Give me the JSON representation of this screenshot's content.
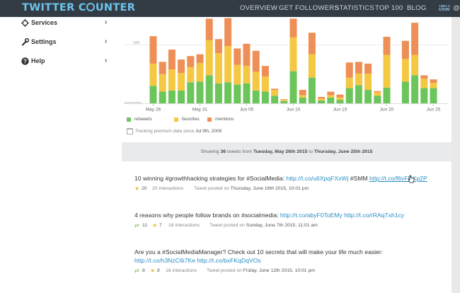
{
  "brand": {
    "part1": "TWITTER C",
    "part2": "UNTER",
    "accent": "#6cc3ec",
    "nav_bg": "#333c44"
  },
  "nav": {
    "items": [
      "OVERVIEW",
      "GET FOLLOWERS",
      "STATISTICS",
      "TOP 100",
      "BLOG"
    ],
    "mini_badge": "TWITTER COUNTER",
    "at_symbol": "@"
  },
  "sidebar": {
    "items": [
      {
        "label": "Services",
        "icon": "crosshair-icon"
      },
      {
        "label": "Settings",
        "icon": "wrench-icon"
      },
      {
        "label": "Help",
        "icon": "help-icon"
      }
    ]
  },
  "chart_data": {
    "type": "bar",
    "stacked": true,
    "colors": {
      "retweets": "#6bc55b",
      "favorites": "#f4c842",
      "mentions": "#ee8f57"
    },
    "gridline_value": 100,
    "ylim": [
      0,
      160
    ],
    "tick_labels": [
      "May 26",
      "May 31",
      "Jun 05",
      "Jun 10",
      "Jun 15",
      "Jun 20",
      "Jun 25"
    ],
    "tick_index": [
      0,
      5,
      10,
      15,
      20,
      25,
      30
    ],
    "categories": [
      "May 26",
      "May 27",
      "May 28",
      "May 29",
      "May 30",
      "May 31",
      "Jun 01",
      "Jun 02",
      "Jun 03",
      "Jun 04",
      "Jun 05",
      "Jun 06",
      "Jun 07",
      "Jun 08",
      "Jun 09",
      "Jun 10",
      "Jun 11",
      "Jun 12",
      "Jun 13",
      "Jun 14",
      "Jun 15",
      "Jun 16",
      "Jun 17",
      "Jun 18",
      "Jun 19",
      "Jun 20",
      "Jun 21",
      "Jun 22",
      "Jun 23",
      "Jun 24",
      "Jun 25"
    ],
    "series": [
      {
        "name": "retweets",
        "values": [
          30,
          20,
          22,
          22,
          36,
          37,
          48,
          34,
          36,
          32,
          34,
          22,
          20,
          13,
          4,
          55,
          10,
          44,
          5,
          10,
          6,
          26,
          31,
          23,
          13,
          27,
          0,
          37,
          48,
          26,
          26
        ]
      },
      {
        "name": "favorites",
        "values": [
          38,
          30,
          36,
          30,
          26,
          32,
          60,
          52,
          62,
          34,
          30,
          32,
          26,
          10,
          2,
          58,
          4,
          40,
          3,
          4,
          4,
          18,
          20,
          28,
          6,
          56,
          0,
          39,
          35,
          16,
          9
        ]
      },
      {
        "name": "mentions",
        "values": [
          47,
          21,
          34,
          23,
          19,
          15,
          37,
          24,
          48,
          28,
          38,
          36,
          18,
          2,
          1,
          32,
          9,
          37,
          3,
          6,
          5,
          26,
          20,
          17,
          2,
          31,
          0,
          31,
          55,
          6,
          6
        ]
      }
    ]
  },
  "legend": [
    "retweets",
    "favorites",
    "mentions"
  ],
  "tracking": {
    "text": "Tracking premium data since ",
    "date": "Jul 9th, 2009"
  },
  "showing": {
    "prefix": "Showing ",
    "count": "36",
    "mid": " tweets from ",
    "from": "Tuesday, May 26th 2015",
    "to_word": " to ",
    "to": "Thursday, June 25th 2015"
  },
  "tweets": [
    {
      "text": "10 winning #growthhacking strategies for #SocialMedia: ",
      "link1": "http://t.co/u6XpqFXxWj",
      "mid": " #SMM ",
      "link2": "http://t.co/f6vFRXp2P",
      "favorites": "20",
      "interactions": "20 interactions",
      "posted_label": "Tweet posted on ",
      "date": "Thursday, June 18th 2015, 10:01 pm"
    },
    {
      "text": "4 reasons why people follow brands on #socialmedia: ",
      "link1": "http://t.co/abyF0ToEMy",
      "mid": " ",
      "link2": "http://t.co/rRAqTxh1cy",
      "retweets": "11",
      "favorites": "7",
      "interactions": "18 interactions",
      "posted_label": "Tweet posted on ",
      "date": "Sunday, June 7th 2015, 11:01 am"
    },
    {
      "text": "Are you a #SocialMediaManager? Check out 10 secrets that will make your life much easier:",
      "link1": "http://t.co/h3NzC6i7Ke",
      "mid": " ",
      "link2": "http://t.co/bxFKqDqVOs",
      "retweets": "8",
      "favorites": "8",
      "interactions": "16 interactions",
      "posted_label": "Tweet posted on ",
      "date": "Friday, June 12th 2015, 10:01 pm"
    }
  ]
}
